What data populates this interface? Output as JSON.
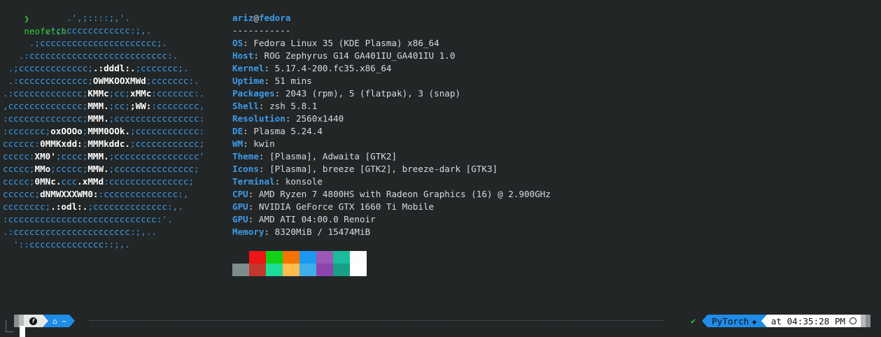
{
  "prompt": {
    "symbol": "❯",
    "command": "neofetch"
  },
  "logo": {
    "lines": [
      [
        {
          "t": "            .',;::::;,'."
        }
      ],
      [
        {
          "t": "        .';:cccccccccccc:;,."
        }
      ],
      [
        {
          "t": "     .;cccccccccccccccccccccc;."
        }
      ],
      [
        {
          "t": "   .:cccccccccccccccccccccccccc:."
        }
      ],
      [
        {
          "t": " .;ccccccccccccc;"
        },
        {
          "t": ".:dddl:.",
          "b": true
        },
        {
          "t": ";ccccccc;."
        }
      ],
      [
        {
          "t": " .:ccccccccccccc;"
        },
        {
          "t": "OWMKOOXMWd",
          "b": true
        },
        {
          "t": ";ccccccc:."
        }
      ],
      [
        {
          "t": ".:ccccccccccccc;"
        },
        {
          "t": "KMMc",
          "b": true
        },
        {
          "t": ";cc;"
        },
        {
          "t": "xMMc",
          "b": true
        },
        {
          "t": ":ccccccc:."
        }
      ],
      [
        {
          "t": ",cccccccccccccc;"
        },
        {
          "t": "MMM.",
          "b": true
        },
        {
          "t": ";cc;"
        },
        {
          "t": ";WW:",
          "b": true
        },
        {
          "t": ":cccccccc,"
        }
      ],
      [
        {
          "t": ":cccccccccccccc;"
        },
        {
          "t": "MMM.",
          "b": true
        },
        {
          "t": ";cccccccccccccccc:"
        }
      ],
      [
        {
          "t": ":ccccccc;"
        },
        {
          "t": "oxOOOo",
          "b": true
        },
        {
          "t": ";"
        },
        {
          "t": "MMM0OOk.",
          "b": true
        },
        {
          "t": ";cccccccccccc:"
        }
      ],
      [
        {
          "t": "cccccc:"
        },
        {
          "t": "0MMKxdd:",
          "b": true
        },
        {
          "t": ";"
        },
        {
          "t": "MMMkddc.",
          "b": true
        },
        {
          "t": ";cccccccccccc;"
        }
      ],
      [
        {
          "t": "ccccc:"
        },
        {
          "t": "XM0'",
          "b": true
        },
        {
          "t": ";cccc;"
        },
        {
          "t": "MMM.",
          "b": true
        },
        {
          "t": ";cccccccccccccccc'"
        }
      ],
      [
        {
          "t": "ccccc;"
        },
        {
          "t": "MMo",
          "b": true
        },
        {
          "t": ";ccccc;"
        },
        {
          "t": "MMW.",
          "b": true
        },
        {
          "t": ";ccccccccccccccc;"
        }
      ],
      [
        {
          "t": "ccccc;"
        },
        {
          "t": "0MNc.",
          "b": true
        },
        {
          "t": "ccc"
        },
        {
          "t": ".xMMd",
          "b": true
        },
        {
          "t": ":ccccccccccccccc;"
        }
      ],
      [
        {
          "t": "cccccc;"
        },
        {
          "t": "dNMWXXXWM0:",
          "b": true
        },
        {
          "t": ":cccccccccccccc:,"
        }
      ],
      [
        {
          "t": "cccccccc;"
        },
        {
          "t": ".:odl:.",
          "b": true
        },
        {
          "t": ";cccccccccccccc:,."
        }
      ],
      [
        {
          "t": ":cccccccccccccccccccccccccccc:'."
        }
      ],
      [
        {
          "t": ".:cccccccccccccccccccccc:;,.."
        }
      ],
      [
        {
          "t": "  '::cccccccccccccc::;,."
        }
      ]
    ]
  },
  "info": {
    "user": "ariz",
    "at": "@",
    "host": "fedora",
    "separator": "-----------",
    "rows": [
      {
        "key": "OS",
        "value": "Fedora Linux 35 (KDE Plasma) x86_64"
      },
      {
        "key": "Host",
        "value": "ROG Zephyrus G14 GA401IU_GA401IU 1.0"
      },
      {
        "key": "Kernel",
        "value": "5.17.4-200.fc35.x86_64"
      },
      {
        "key": "Uptime",
        "value": "51 mins"
      },
      {
        "key": "Packages",
        "value": "2043 (rpm), 5 (flatpak), 3 (snap)"
      },
      {
        "key": "Shell",
        "value": "zsh 5.8.1"
      },
      {
        "key": "Resolution",
        "value": "2560x1440"
      },
      {
        "key": "DE",
        "value": "Plasma 5.24.4"
      },
      {
        "key": "WM",
        "value": "kwin"
      },
      {
        "key": "Theme",
        "value": "[Plasma], Adwaita [GTK2]"
      },
      {
        "key": "Icons",
        "value": "[Plasma], breeze [GTK2], breeze-dark [GTK3]"
      },
      {
        "key": "Terminal",
        "value": "konsole"
      },
      {
        "key": "CPU",
        "value": "AMD Ryzen 7 4800HS with Radeon Graphics (16) @ 2.900GHz"
      },
      {
        "key": "GPU",
        "value": "NVIDIA GeForce GTX 1660 Ti Mobile"
      },
      {
        "key": "GPU",
        "value": "AMD ATI 04:00.0 Renoir"
      },
      {
        "key": "Memory",
        "value": "8320MiB / 15474MiB"
      }
    ],
    "key_suffix": ": "
  },
  "palette": {
    "row1": [
      "#222627",
      "#ed1515",
      "#11d116",
      "#f67400",
      "#1d99f3",
      "#9b59b6",
      "#1abc9c",
      "#fcfcfc"
    ],
    "row2": [
      "#7f8c8d",
      "#c0392b",
      "#1cdc9a",
      "#fdbc4b",
      "#3daee9",
      "#8e44ad",
      "#16a085",
      "#ffffff"
    ]
  },
  "statusbar": {
    "os_icon": "f",
    "home_icon": "⌂",
    "dir": "~",
    "check": "✔",
    "env_name": "PyTorch",
    "env_icon": "✚",
    "time": "at 04:35:28 PM",
    "accent": "#1f8ce8"
  }
}
